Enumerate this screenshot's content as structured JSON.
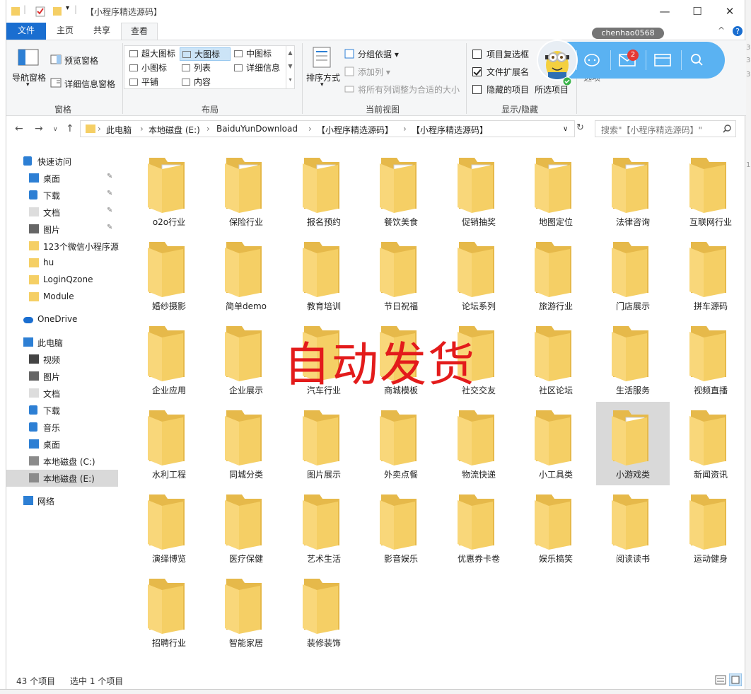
{
  "window": {
    "title": "【小程序精选源码】"
  },
  "ribbon_tabs": [
    "文件",
    "主页",
    "共享",
    "查看"
  ],
  "user": {
    "name": "chenhao0568"
  },
  "ribbon": {
    "pane_group": {
      "nav_pane": "导航窗格",
      "preview_pane": "预览窗格",
      "details_pane": "详细信息窗格",
      "label": "窗格"
    },
    "layout_group": {
      "items": [
        "超大图标",
        "大图标",
        "中图标",
        "小图标",
        "列表",
        "详细信息",
        "平铺",
        "内容"
      ],
      "selected": "大图标",
      "label": "布局"
    },
    "view_group": {
      "sort_by": "排序方式",
      "group_by": "分组依据",
      "add_columns": "添加列",
      "fit_columns": "将所有列调整为合适的大小",
      "label": "当前视图"
    },
    "show_hide_group": {
      "item_checkboxes": "项目复选框",
      "file_extensions": "文件扩展名",
      "hidden_items": "隐藏的项目",
      "hide_selected": "所选项目",
      "options": "选项",
      "label": "显示/隐藏",
      "item_checkboxes_checked": false,
      "file_extensions_checked": true,
      "hidden_items_checked": false
    }
  },
  "float_widget": {
    "badge": "2"
  },
  "address": {
    "crumbs": [
      "此电脑",
      "本地磁盘 (E:)",
      "BaiduYunDownload",
      "【小程序精选源码】",
      "【小程序精选源码】"
    ],
    "search_placeholder": "搜索\"【小程序精选源码】\""
  },
  "nav": {
    "quick_access": "快速访问",
    "quick_items": [
      "桌面",
      "下载",
      "文档",
      "图片",
      "123个微信小程序源",
      "hu",
      "LoginQzone",
      "Module"
    ],
    "onedrive": "OneDrive",
    "this_pc": "此电脑",
    "pc_items": [
      "视频",
      "图片",
      "文档",
      "下载",
      "音乐",
      "桌面",
      "本地磁盘 (C:)",
      "本地磁盘 (E:)"
    ],
    "network": "网络",
    "selected": "本地磁盘 (E:)"
  },
  "folders": [
    {
      "name": "o2o行业",
      "docs": true
    },
    {
      "name": "保险行业",
      "docs": true
    },
    {
      "name": "报名预约",
      "docs": true
    },
    {
      "name": "餐饮美食",
      "docs": true
    },
    {
      "name": "促销抽奖",
      "docs": true
    },
    {
      "name": "地图定位",
      "docs": true
    },
    {
      "name": "法律咨询",
      "docs": true
    },
    {
      "name": "互联网行业",
      "docs": false
    },
    {
      "name": "婚纱摄影",
      "docs": false
    },
    {
      "name": "简单demo",
      "docs": false
    },
    {
      "name": "教育培训",
      "docs": false
    },
    {
      "name": "节日祝福",
      "docs": false
    },
    {
      "name": "论坛系列",
      "docs": false
    },
    {
      "name": "旅游行业",
      "docs": false
    },
    {
      "name": "门店展示",
      "docs": false
    },
    {
      "name": "拼车源码",
      "docs": false
    },
    {
      "name": "企业应用",
      "docs": false
    },
    {
      "name": "企业展示",
      "docs": false
    },
    {
      "name": "汽车行业",
      "docs": false
    },
    {
      "name": "商城模板",
      "docs": false
    },
    {
      "name": "社交交友",
      "docs": false
    },
    {
      "name": "社区论坛",
      "docs": false
    },
    {
      "name": "生活服务",
      "docs": false
    },
    {
      "name": "视频直播",
      "docs": false
    },
    {
      "name": "水利工程",
      "docs": false
    },
    {
      "name": "同城分类",
      "docs": false
    },
    {
      "name": "图片展示",
      "docs": false
    },
    {
      "name": "外卖点餐",
      "docs": false
    },
    {
      "name": "物流快递",
      "docs": false
    },
    {
      "name": "小工具类",
      "docs": false
    },
    {
      "name": "小游戏类",
      "docs": true
    },
    {
      "name": "新闻资讯",
      "docs": false
    },
    {
      "name": "演绎博览",
      "docs": false
    },
    {
      "name": "医疗保健",
      "docs": false
    },
    {
      "name": "艺术生活",
      "docs": false
    },
    {
      "name": "影音娱乐",
      "docs": false
    },
    {
      "name": "优惠券卡卷",
      "docs": false
    },
    {
      "name": "娱乐搞笑",
      "docs": false
    },
    {
      "name": "阅读读书",
      "docs": false
    },
    {
      "name": "运动健身",
      "docs": false
    },
    {
      "name": "招聘行业",
      "docs": false
    },
    {
      "name": "智能家居",
      "docs": false
    },
    {
      "name": "装修装饰",
      "docs": false
    }
  ],
  "selected_folder": "小游戏类",
  "watermark": "自动发货",
  "status": {
    "count": "43 个项目",
    "selection": "选中 1 个项目"
  },
  "colors": {
    "accent": "#1a6ed0",
    "folder": "#f5cf65",
    "watermark": "#e31b1b",
    "widget": "#5ab2f2"
  }
}
